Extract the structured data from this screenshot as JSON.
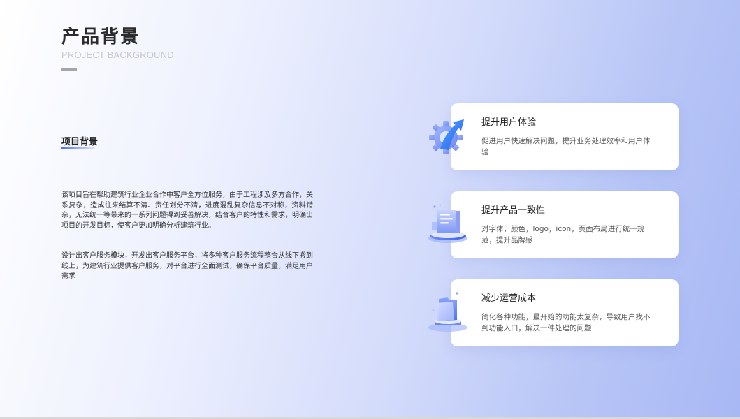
{
  "header": {
    "title": "产品背景",
    "subtitle": "PROJECT BACKGROUND"
  },
  "section": {
    "heading": "项目背景",
    "paragraphs": [
      "该项目旨在帮助建筑行业企业合作中客户全方位服务，由于工程涉及多方合作，关系复杂，造成往来结算不清、责任划分不清，进度混乱复杂信息不对称，资料错杂，无法统一等带来的一系列问题得到妥善解决，结合客户的特性和需求，明确出项目的开发目标，使客户更加明确分析建筑行业。",
      "设计出客户服务模块，开发出客户服务平台，将多种客户服务流程整合从线下搬到线上，为建筑行业提供客户服务，对平台进行全面测试，确保平台质量，满足用户需求"
    ]
  },
  "cards": [
    {
      "title": "提升用户体验",
      "desc": "促进用户快速解决问题，提升业务处理效率和用户体验",
      "icon": "gear-arrow-icon"
    },
    {
      "title": "提升产品一致性",
      "desc": "对字体，颜色，logo，icon，页面布局进行统一规范，提升品牌感",
      "icon": "document-platform-icon"
    },
    {
      "title": "减少运营成本",
      "desc": "简化各种功能，最开始的功能太复杂，导致用户找不到功能入口，解决一件处理的问题",
      "icon": "folder-platform-icon"
    }
  ],
  "colors": {
    "accent": "#4d6ef5",
    "title": "#2b2b2b",
    "subtitle": "#c9c9cc"
  }
}
